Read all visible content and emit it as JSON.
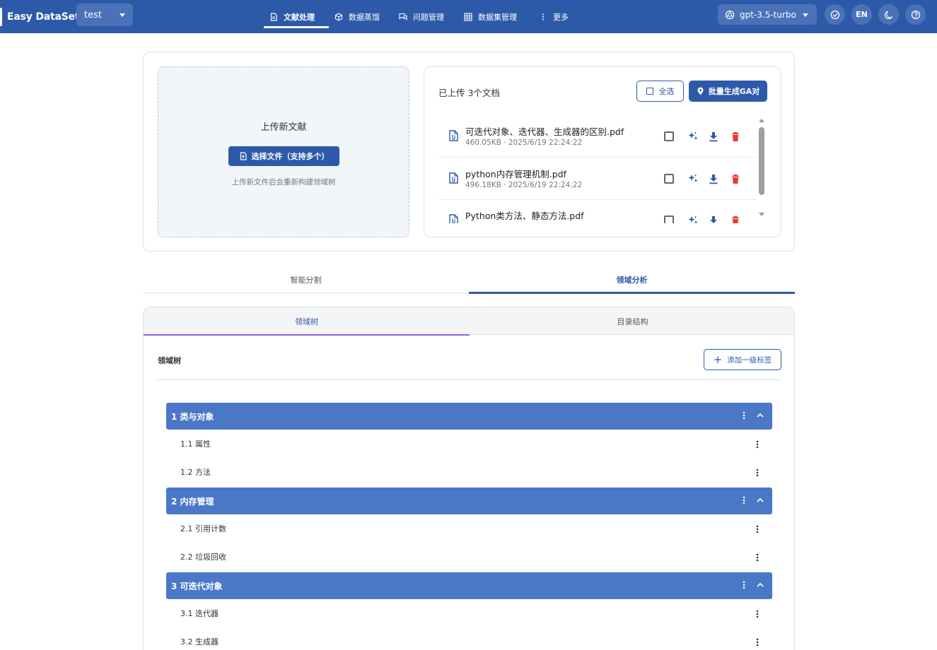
{
  "app": {
    "brand": "Easy DataSet",
    "project": "test"
  },
  "nav": [
    {
      "label": "文献处理",
      "icon": "document-icon",
      "active": true
    },
    {
      "label": "数据蒸馏",
      "icon": "cube-icon",
      "active": false
    },
    {
      "label": "问题管理",
      "icon": "chat-icon",
      "active": false
    },
    {
      "label": "数据集管理",
      "icon": "grid-icon",
      "active": false
    },
    {
      "label": "更多",
      "icon": "more-vertical-icon",
      "active": false
    }
  ],
  "header_right": {
    "model": "gpt-3.5-turbo",
    "lang": "EN"
  },
  "upload": {
    "title": "上传新文献",
    "button": "选择文件（支持多个）",
    "hint": "上传新文件后会重新构建领域树"
  },
  "files": {
    "title": "已上传 3个文档",
    "select_all": "全选",
    "batch": "批量生成GA对",
    "items": [
      {
        "name": "可迭代对象、迭代器、生成器的区别.pdf",
        "meta": "460.05KB · 2025/6/19 22:24:22"
      },
      {
        "name": "python内存管理机制.pdf",
        "meta": "496.18KB · 2025/6/19 22:24:22"
      },
      {
        "name": "Python类方法、静态方法.pdf",
        "meta": ""
      }
    ]
  },
  "main_tabs": [
    "智能分割",
    "领域分析"
  ],
  "sub_tabs": [
    "领域树",
    "目录结构"
  ],
  "domain": {
    "title": "领域树",
    "add_button": "添加一级标签",
    "tree": [
      {
        "label": "1 类与对象",
        "children": [
          "1.1 属性",
          "1.2 方法"
        ]
      },
      {
        "label": "2 内存管理",
        "children": [
          "2.1 引用计数",
          "2.2 垃圾回收"
        ]
      },
      {
        "label": "3 可迭代对象",
        "children": [
          "3.1 迭代器",
          "3.2 生成器"
        ]
      }
    ]
  },
  "colors": {
    "primary": "#2d5aa8",
    "tree_header": "#4a78c6",
    "danger": "#e53935",
    "subtab_indicator": "#8b63d8"
  }
}
